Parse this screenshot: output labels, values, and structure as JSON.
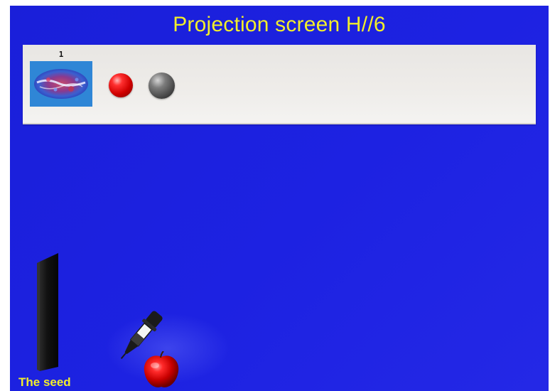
{
  "window": {
    "title": "Projection screen H//6"
  },
  "panel": {
    "slot": {
      "number": "1",
      "thumbnail_icon": "galaxy-map-icon"
    },
    "balls": [
      {
        "name": "red-ball",
        "color": "#d00000"
      },
      {
        "name": "grey-ball",
        "color": "#555555"
      }
    ]
  },
  "seed": {
    "label": "The seed",
    "icon": "black-slab-icon"
  },
  "tools": {
    "dropper_icon": "pipette-icon",
    "apple_icon": "apple-icon",
    "apple_color": "#d30000"
  },
  "colors": {
    "background": "#1d22e2",
    "title_text": "#f2ee2a",
    "panel": "#eeece9"
  }
}
